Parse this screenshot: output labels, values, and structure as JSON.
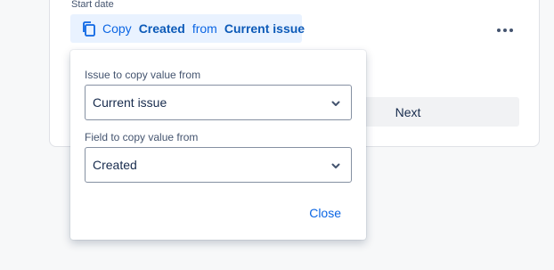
{
  "field": {
    "label": "Start date"
  },
  "copy_chip": {
    "prefix": "Copy",
    "field_name": "Created",
    "connector": "from",
    "source": "Current issue",
    "icon": "copy-icon"
  },
  "more_menu": {
    "icon": "more-horizontal-icon"
  },
  "next_button": {
    "label": "Next"
  },
  "popup": {
    "issue_label": "Issue to copy value from",
    "issue_value": "Current issue",
    "field_label": "Field to copy value from",
    "field_value": "Created",
    "close_label": "Close"
  },
  "colors": {
    "accent": "#0c66e4",
    "chip_bg": "#e9f2ff",
    "border": "#8590a2",
    "muted_text": "#44546f"
  }
}
